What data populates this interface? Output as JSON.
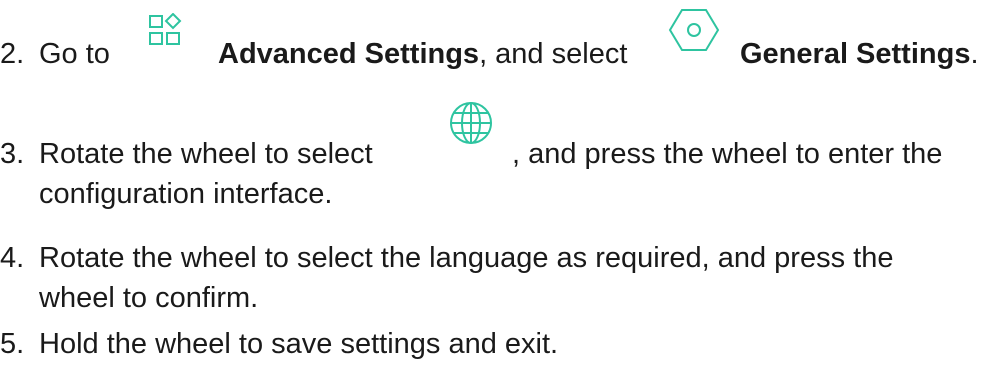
{
  "steps": [
    {
      "number": "2.",
      "parts": {
        "go_to": "Go to",
        "advanced_settings": "Advanced Settings",
        "and_select": ", and select",
        "general_settings": "General Settings",
        "period": "."
      },
      "icons": [
        "advanced-settings-grid-icon",
        "general-settings-hexagon-icon"
      ]
    },
    {
      "number": "3.",
      "line1_a": "Rotate the wheel to select",
      "line1_b": ", and press the wheel to enter the",
      "line2": "configuration interface.",
      "icon": "globe-icon"
    },
    {
      "number": "4.",
      "line1": "Rotate the wheel to select the language as required, and press the",
      "line2": "wheel to confirm."
    },
    {
      "number": "5.",
      "line1": "Hold the wheel to save settings and exit."
    }
  ],
  "colors": {
    "text": "#1a1a1a",
    "icon_accent": "#2ec4a0"
  }
}
